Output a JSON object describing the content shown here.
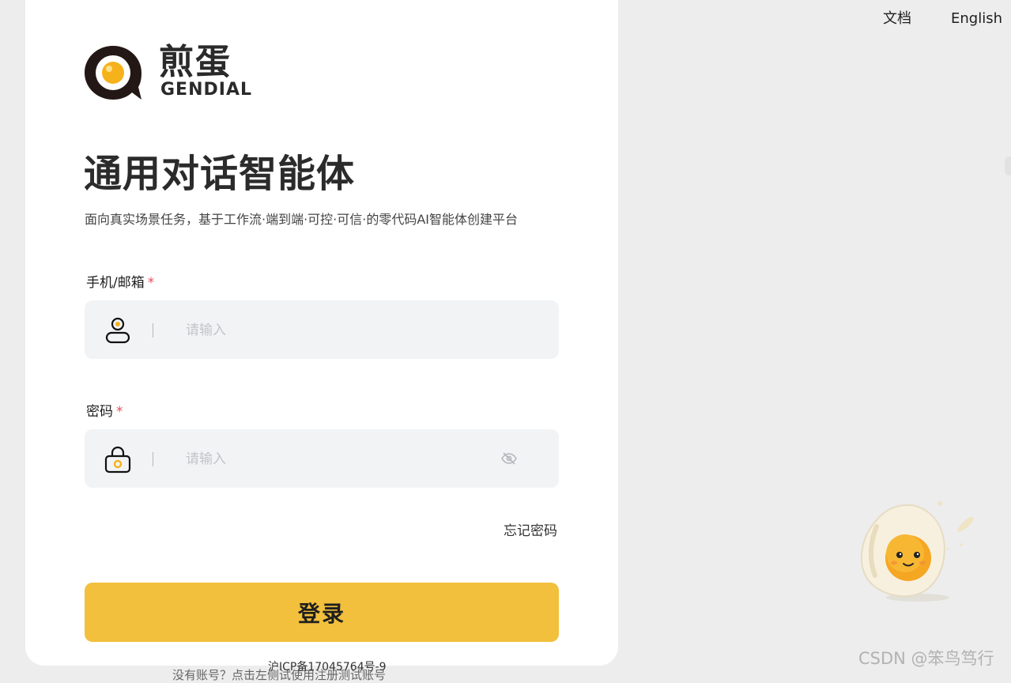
{
  "brand": {
    "name_cn": "煎蛋",
    "name_en": "GENDIAL",
    "accent_color": "#f2c03d"
  },
  "header": {
    "docs_label": "文档",
    "language_label": "English"
  },
  "hero": {
    "title": "通用对话智能体",
    "subtitle": "面向真实场景任务，基于工作流·端到端·可控·可信·的零代码AI智能体创建平台"
  },
  "form": {
    "account": {
      "label": "手机/邮箱",
      "required_mark": "*",
      "placeholder": "请输入",
      "value": "",
      "icon": "user-icon"
    },
    "password": {
      "label": "密码",
      "required_mark": "*",
      "placeholder": "请输入",
      "value": "",
      "icon": "lock-icon",
      "toggle_icon": "eye-off-icon"
    },
    "forgot_label": "忘记密码",
    "submit_label": "登录"
  },
  "footer": {
    "register_hint": "没有账号？点击左侧试使用注册测试账号",
    "icp": "沪ICP备17045764号-9"
  },
  "watermark": "CSDN @笨鸟笃行"
}
